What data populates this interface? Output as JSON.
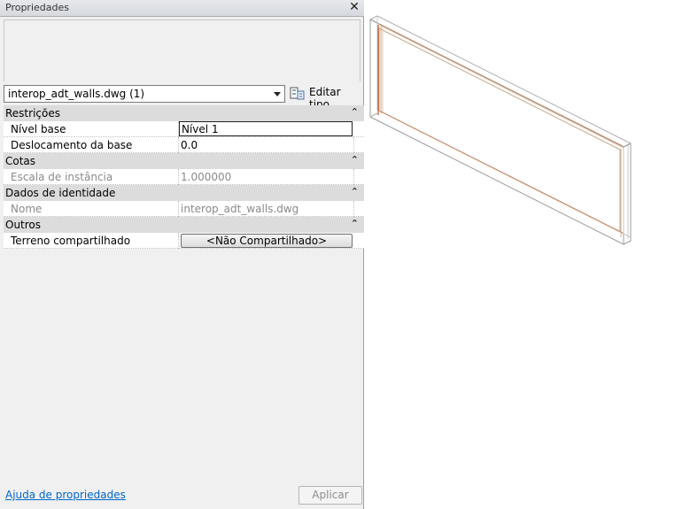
{
  "panel": {
    "title": "Propriedades",
    "close_glyph": "✕",
    "type_selector": "interop_adt_walls.dwg (1)",
    "edit_type_label": "Editar tipo",
    "help_link": "Ajuda de propriedades",
    "apply_label": "Aplicar"
  },
  "categories": {
    "restricoes": "Restrições",
    "cotas": "Cotas",
    "identidade": "Dados de identidade",
    "outros": "Outros"
  },
  "props": {
    "nivel_base": {
      "label": "Nível base",
      "value": "Nível 1"
    },
    "deslocamento": {
      "label": "Deslocamento da base",
      "value": "0.0"
    },
    "escala": {
      "label": "Escala de instância",
      "value": "1.000000"
    },
    "nome": {
      "label": "Nome",
      "value": "interop_adt_walls.dwg"
    },
    "terreno": {
      "label": "Terreno compartilhado",
      "value": "<Não Compartilhado>"
    }
  },
  "icons": {
    "close": "close-icon",
    "dropdown": "chevron-down-icon",
    "edit_type": "edit-type-icon",
    "collapse": "chevron-up-double-icon"
  },
  "colors": {
    "category_bg": "#dcdcdc",
    "link": "#0066cc",
    "disabled_text": "#8a8a8a",
    "wall_outline": "#b0b0b0",
    "wall_accent": "#b85a30"
  }
}
